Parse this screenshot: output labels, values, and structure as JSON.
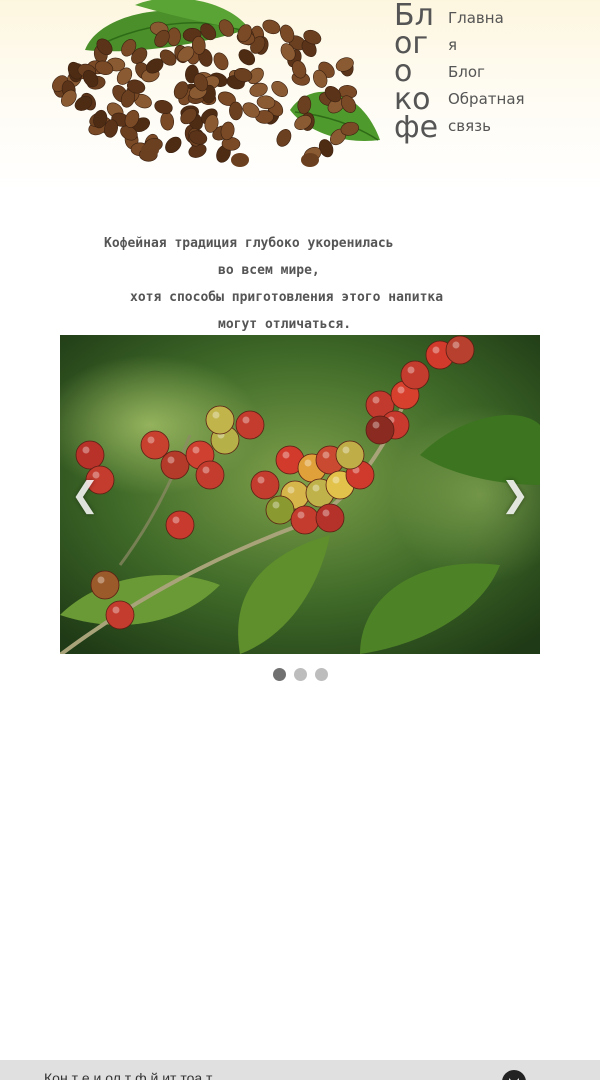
{
  "header": {
    "title_lines": [
      "Бл",
      "ог",
      "о",
      "ко",
      "фе"
    ],
    "nav": [
      {
        "label_lines": [
          "Главна",
          "я"
        ]
      },
      {
        "label_lines": [
          "Блог"
        ]
      },
      {
        "label_lines": [
          "Обратная",
          "связь"
        ]
      }
    ],
    "hero_icon": "coffee-beans-icon"
  },
  "intro": {
    "lines": [
      "Кофейная традиция глубоко укоренилась",
      "во всем мире,",
      "хотя способы приготовления этого напитка",
      "могут отличаться."
    ]
  },
  "carousel": {
    "prev_label": "❮",
    "next_label": "❯",
    "slide_count": 3,
    "active_slide": 1,
    "slide_icon": "coffee-cherries-photo"
  },
  "footer": {
    "text": "Кон  т   е   и   ол   т   ф   й  ит   тоа   т",
    "icon": "github-icon"
  },
  "colors": {
    "text": "#555555",
    "header_bg": "#fdf6df",
    "footer_bg": "#e0e0e0",
    "dot_active": "#717171",
    "dot_inactive": "#bdbdbd"
  }
}
